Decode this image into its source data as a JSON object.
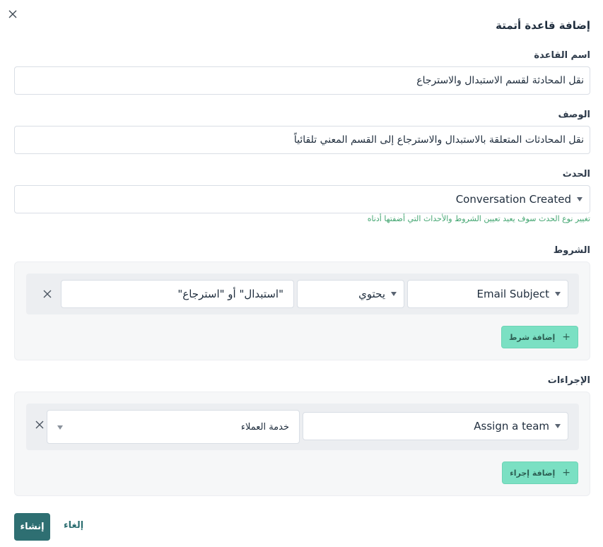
{
  "dialog": {
    "title": "إضافة قاعدة أتمتة",
    "close_icon": "close-icon"
  },
  "rule_name": {
    "label": "اسم القاعدة",
    "value": "نقل المحادثة لقسم الاستبدال والاسترجاع"
  },
  "description": {
    "label": "الوصف",
    "value": "نقل المحادثات المتعلقة بالاستبدال والاسترجاع إلى القسم المعني تلقائياً"
  },
  "event": {
    "label": "الحدث",
    "value": "Conversation Created",
    "hint": "تغيير نوع الحدث سوف يعيد تعيين الشروط والأحداث التي أضفتها أدناه"
  },
  "conditions": {
    "label": "الشروط",
    "rows": [
      {
        "attribute": "Email Subject",
        "operator": "يحتوي",
        "value": "\"استبدال\" أو \"استرجاع\""
      }
    ],
    "add_label": "إضافة شرط"
  },
  "actions": {
    "label": "الإجراءات",
    "rows": [
      {
        "action": "Assign a team",
        "value": "خدمة العملاء"
      }
    ],
    "add_label": "إضافة إجراء"
  },
  "footer": {
    "create_label": "إنشاء",
    "cancel_label": "إلغاء"
  },
  "colors": {
    "primary": "#2e6f72",
    "add_button": "#7be0c3",
    "hint": "#44a672"
  }
}
